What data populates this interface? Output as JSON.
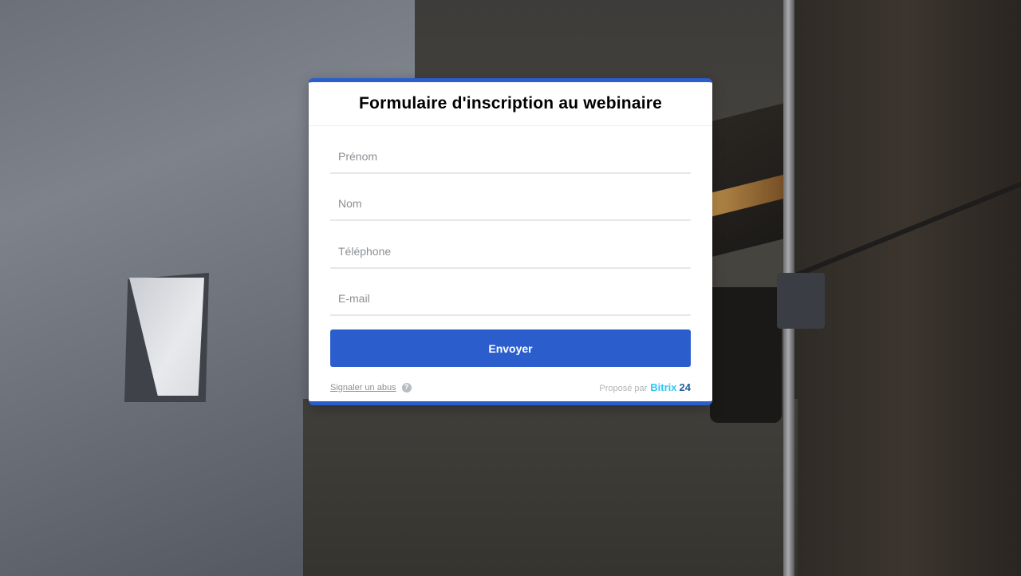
{
  "form": {
    "title": "Formulaire d'inscription au webinaire",
    "fields": [
      {
        "placeholder": "Prénom",
        "value": ""
      },
      {
        "placeholder": "Nom",
        "value": ""
      },
      {
        "placeholder": "Téléphone",
        "value": ""
      },
      {
        "placeholder": "E-mail",
        "value": ""
      }
    ],
    "submit_label": "Envoyer"
  },
  "footer": {
    "report_label": "Signaler un abus",
    "help_icon": "question-mark-icon",
    "help_glyph": "?",
    "powered_label": "Proposé par",
    "brand_name": "Bitrix",
    "brand_number": "24"
  },
  "colors": {
    "accent": "#2b5dcc",
    "brand_light_blue": "#2fc6f6",
    "brand_dark_blue": "#215f98"
  }
}
